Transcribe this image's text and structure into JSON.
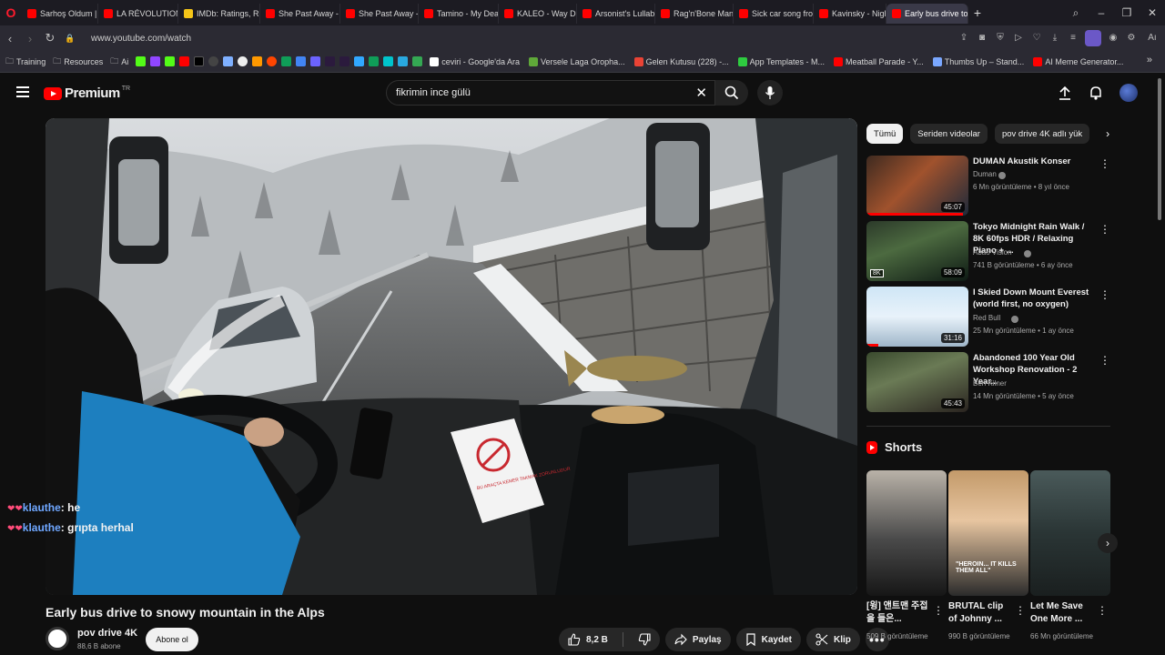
{
  "browser": {
    "tabs": [
      {
        "label": "Sarhoş Oldum | Tol",
        "color": "#ff0000"
      },
      {
        "label": "LA RÉVOLUTION FR",
        "color": "#ff0000"
      },
      {
        "label": "IMDb: Ratings, Revi",
        "color": "#f5c518"
      },
      {
        "label": "She Past Away - Ka",
        "color": "#ff0000"
      },
      {
        "label": "She Past Away - Du",
        "color": "#ff0000"
      },
      {
        "label": "Tamino - My Deare",
        "color": "#ff0000"
      },
      {
        "label": "KALEO - Way Down",
        "color": "#ff0000"
      },
      {
        "label": "Arsonist's Lullaby (",
        "color": "#ff0000"
      },
      {
        "label": "Rag'n'Bone Man - I",
        "color": "#ff0000"
      },
      {
        "label": "Sick car song from",
        "color": "#ff0000"
      },
      {
        "label": "Kavinsky - Nightca",
        "color": "#ff0000"
      },
      {
        "label": "Early bus drive to sno",
        "color": "#ff0000"
      }
    ],
    "new_tab": "+",
    "url": "www.youtube.com/watch",
    "bookmarks": [
      {
        "label": "Training"
      },
      {
        "label": "Resources"
      },
      {
        "label": "Ai"
      }
    ],
    "bookmarks_right": [
      {
        "label": "ceviri - Google'da Ara",
        "color": "#ffffff"
      },
      {
        "label": "Versele Laga Oropha...",
        "color": "#5fa839"
      },
      {
        "label": "Gelen Kutusu (228) -...",
        "color": "#ea4335"
      },
      {
        "label": "App Templates - M...",
        "color": "#2ecc40"
      },
      {
        "label": "Meatball Parade - Y...",
        "color": "#ff0000"
      },
      {
        "label": "Thumbs Up – Stand...",
        "color": "#7aa7ff"
      },
      {
        "label": "AI Meme Generator...",
        "color": "#ff0000"
      }
    ],
    "bookmarks_more": "»"
  },
  "header": {
    "brand": "Premium",
    "region": "TR",
    "search_query": "fikrimin ince gülü"
  },
  "video": {
    "title": "Early bus drive to snowy mountain in the Alps",
    "channel": "pov drive 4K",
    "subscribers": "88,6 B abone",
    "subscribe_label": "Abone ol",
    "likes": "8,2 B",
    "share_label": "Paylaş",
    "save_label": "Kaydet",
    "clip_label": "Klip",
    "sign_text": "BU ARAÇTA KEMER TAKMAK ZORUNLUDUR"
  },
  "chat": [
    {
      "user": "klauthe",
      "message": "he"
    },
    {
      "user": "klauthe",
      "message": "grıpta herhal"
    }
  ],
  "sidebar": {
    "chips": [
      "Tümü",
      "Seriden videolar",
      "pov drive 4K adlı yük"
    ],
    "recommendations": [
      {
        "title": "DUMAN Akustik Konser",
        "channel": "Duman",
        "verified": true,
        "meta": "6 Mn görüntüleme • 8 yıl önce",
        "duration": "45:07",
        "progress": 0.95
      },
      {
        "title": "Tokyo Midnight Rain Walk / 8K 60fps HDR / Relaxing Piano + ...",
        "channel": "Abao Vision",
        "verified": true,
        "meta": "741 B görüntüleme • 6 ay önce",
        "duration": "58:09",
        "badge": "8K"
      },
      {
        "title": "I Skied Down Mount Everest (world first, no oxygen)",
        "channel": "Red Bull",
        "verified": true,
        "meta": "25 Mn görüntüleme • 1 ay önce",
        "duration": "31:16",
        "progress": 0.12
      },
      {
        "title": "Abandoned 100 Year Old Workshop Renovation - 2 Year...",
        "channel": "Ben Kilner",
        "verified": false,
        "meta": "14 Mn görüntüleme • 5 ay önce",
        "duration": "45:43"
      }
    ],
    "shorts_heading": "Shorts",
    "shorts": [
      {
        "title": "[윙] 앤트맨 주접을 들은...",
        "views": "509 B görüntüleme"
      },
      {
        "title": "BRUTAL clip of Johnny ...",
        "views": "990 B görüntüleme",
        "caption": "\"HEROIN... IT KILLS THEM ALL\""
      },
      {
        "title": "Let Me Save One More ...",
        "views": "66 Mn görüntüleme"
      }
    ]
  }
}
